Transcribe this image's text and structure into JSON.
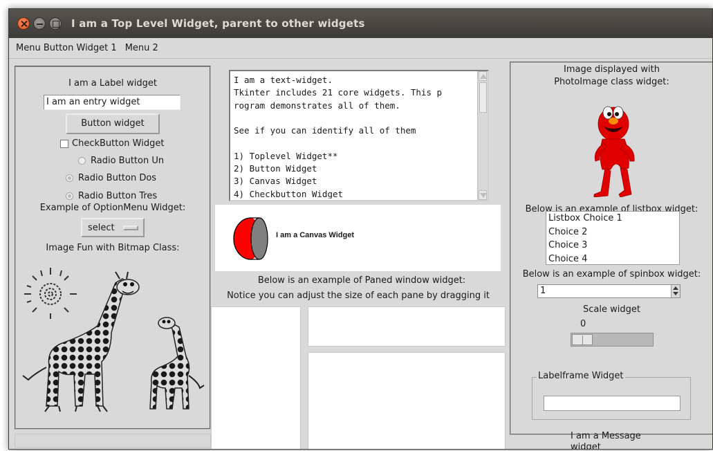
{
  "window": {
    "title": "I am a Top Level Widget, parent to other widgets"
  },
  "menubar": {
    "menu1": "Menu Button Widget 1",
    "menu2": "Menu 2"
  },
  "left": {
    "label": "I am a Label widget",
    "entry_value": "I am an entry widget",
    "button": "Button widget",
    "checkbutton": "CheckButton Widget",
    "radio_un": "Radio Button  Un",
    "radio_dos": "Radio Button  Dos",
    "radio_tres": "Radio Button  Tres",
    "optionmenu_label": "Example of OptionMenu Widget:",
    "optionmenu_value": "select",
    "bitmap_label": "Image Fun with Bitmap Class:"
  },
  "middle": {
    "text_lines": "I am a text-widget.\nTkinter includes 21 core widgets. This p\nrogram demonstrates all of them.\n\nSee if you can identify all of them\n\n1) Toplevel Widget**\n2) Button Widget\n3) Canvas Widget\n4) Checkbutton Widget",
    "canvas_label": "I am a Canvas Widget",
    "paned_line1": "Below is an example of Paned window widget:",
    "paned_line2": "Notice you can adjust the size of each pane by dragging it"
  },
  "right": {
    "photo_line1": "Image displayed with",
    "photo_line2": "PhotoImage class widget:",
    "listbox_label": "Below is an example of listbox widget:",
    "listbox_items": [
      "Listbox Choice 1",
      "Choice 2",
      "Choice 3",
      "Choice 4"
    ],
    "spinbox_label": "Below is an example of spinbox widget:",
    "spinbox_value": "1",
    "scale_label": "Scale widget",
    "scale_value": "0",
    "labelframe_title": "Labelframe Widget",
    "message_line1": "I am a Message",
    "message_line2": "widget"
  },
  "colors": {
    "window_bg": "#d9d9d9",
    "titlebar": "#3c3b37",
    "canvas_red": "#ff0000",
    "canvas_grey": "#808080",
    "elmo_red": "#e00000"
  },
  "icons": [
    "close-icon",
    "minimize-icon",
    "maximize-icon",
    "sun-bitmap",
    "giraffe-bitmap",
    "elmo-photo"
  ]
}
